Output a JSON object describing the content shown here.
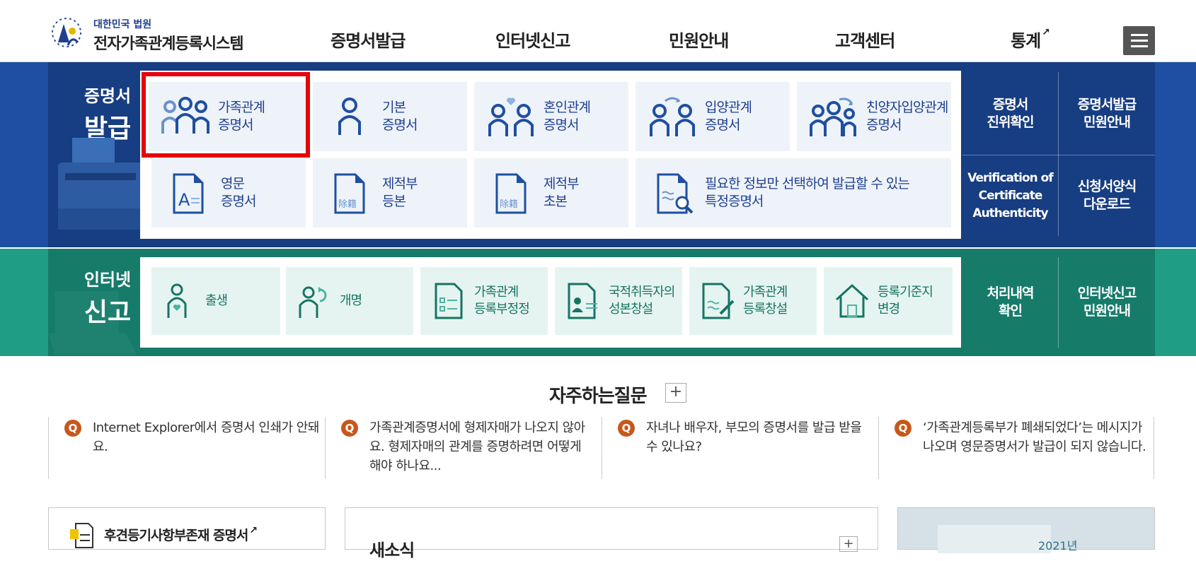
{
  "header": {
    "logo_sub": "대한민국 법원",
    "logo_main": "전자가족관계등록시스템",
    "nav": [
      "증명서발급",
      "인터넷신고",
      "민원안내",
      "고객센터",
      "통계"
    ],
    "menu_icon": "hamburger-icon",
    "external_icon": "external-link-icon"
  },
  "issue": {
    "label_small": "증명서",
    "label_big": "발급",
    "tiles": [
      {
        "label": "가족관계\n증명서",
        "icon": "family-icon"
      },
      {
        "label": "기본\n증명서",
        "icon": "person-icon"
      },
      {
        "label": "혼인관계\n증명서",
        "icon": "couple-heart-icon"
      },
      {
        "label": "입양관계\n증명서",
        "icon": "adoption-icon"
      },
      {
        "label": "친양자입양관계\n증명서",
        "icon": "full-adoption-icon"
      },
      {
        "label": "영문\n증명서",
        "icon": "english-doc-icon"
      },
      {
        "label": "제적부\n등본",
        "icon": "removed-register-icon"
      },
      {
        "label": "제적부\n초본",
        "icon": "removed-register-icon"
      },
      {
        "label": "필요한 정보만 선택하여 발급할 수 있는\n특정증명서",
        "icon": "doc-search-icon"
      }
    ],
    "side": [
      "증명서\n진위확인",
      "증명서발급\n민원안내",
      "Verification of\nCertificate\nAuthenticity",
      "신청서양식\n다운로드"
    ],
    "colors": {
      "band": "#1e4fa2",
      "tile": "#eef3fa",
      "highlight": "#e8000b"
    }
  },
  "report": {
    "label_small": "인터넷",
    "label_big": "신고",
    "tiles": [
      {
        "label": "출생",
        "icon": "birth-icon"
      },
      {
        "label": "개명",
        "icon": "rename-icon"
      },
      {
        "label": "가족관계\n등록부정정",
        "icon": "correction-doc-icon"
      },
      {
        "label": "국적취득자의\n성본창설",
        "icon": "id-card-icon"
      },
      {
        "label": "가족관계\n등록창설",
        "icon": "register-create-icon"
      },
      {
        "label": "등록기준지\n변경",
        "icon": "house-icon"
      }
    ],
    "side": [
      "처리내역\n확인",
      "인터넷신고\n민원안내"
    ],
    "colors": {
      "band": "#1f9e85",
      "tile": "#e6f4f1"
    }
  },
  "faq": {
    "title": "자주하는질문",
    "plus": "+",
    "badge": "Q",
    "items": [
      "Internet Explorer에서 증명서 인쇄가 안돼요.",
      "가족관계증명서에 형제자매가 나오지 않아요. 형제자매의 관계를 증명하려면 어떻게 해야 하나요...",
      "자녀나 배우자, 부모의 증명서를 발급 받을 수 있나요?",
      "‘가족관계등록부가 폐쇄되었다’는 메시지가 나오며 영문증명서가 발급이 되지 않습니다."
    ]
  },
  "bottom": {
    "box1_title": "후견등기사항부존재 증명서",
    "box2_title": "새소식",
    "box2_plus": "+",
    "box3_year": "2021년"
  }
}
